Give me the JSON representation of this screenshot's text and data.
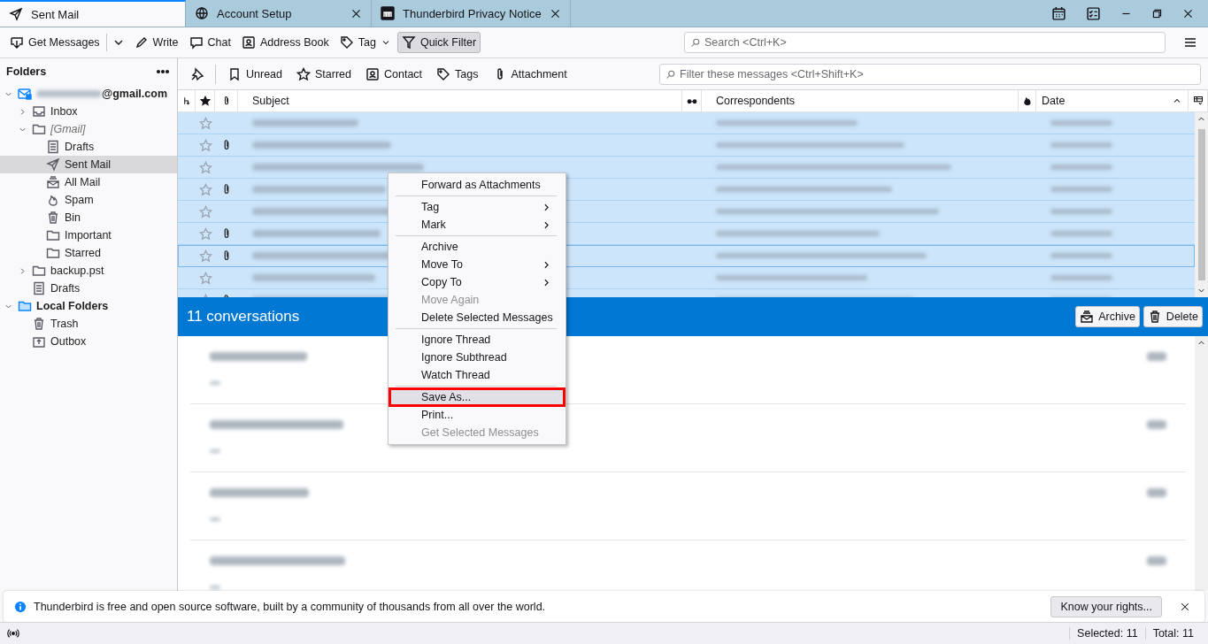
{
  "tabs": [
    {
      "label": "Sent Mail",
      "kind": "sent",
      "selected": true,
      "closable": false
    },
    {
      "label": "Account Setup",
      "kind": "globe",
      "selected": false,
      "closable": true
    },
    {
      "label": "Thunderbird Privacy Notice",
      "kind": "site",
      "selected": false,
      "closable": true
    }
  ],
  "toolbar": {
    "buttons": [
      {
        "kind": "button",
        "label": "Get Messages",
        "pressed": false
      },
      {
        "kind": "dropdown"
      },
      {
        "kind": "button",
        "label": "Write",
        "pressed": false
      },
      {
        "kind": "button",
        "label": "Chat",
        "pressed": false
      },
      {
        "kind": "button",
        "label": "Address Book",
        "pressed": false
      },
      {
        "kind": "menu-button",
        "label": "Tag",
        "pressed": false
      },
      {
        "kind": "button",
        "label": "Quick Filter",
        "pressed": true
      }
    ],
    "search": {
      "placeholder": "Search <Ctrl+K>"
    }
  },
  "folder_pane": {
    "title": "Folders",
    "tree": [
      {
        "label": "@gmail.com",
        "kind": "account",
        "expanded": true,
        "selected": false,
        "children": [
          {
            "label": "Inbox",
            "kind": "inbox",
            "expanded": false,
            "selected": false
          },
          {
            "label": "[Gmail]",
            "kind": "virtual",
            "expanded": true,
            "selected": false,
            "children": [
              {
                "label": "Drafts",
                "kind": "drafts",
                "selected": false
              },
              {
                "label": "Sent Mail",
                "kind": "sent",
                "selected": true
              },
              {
                "label": "All Mail",
                "kind": "archive",
                "selected": false
              },
              {
                "label": "Spam",
                "kind": "spam",
                "selected": false
              },
              {
                "label": "Bin",
                "kind": "bin",
                "selected": false
              },
              {
                "label": "Important",
                "kind": "folder",
                "selected": false
              },
              {
                "label": "Starred",
                "kind": "folder",
                "selected": false
              }
            ]
          },
          {
            "label": "backup.pst",
            "kind": "folder",
            "expanded": false,
            "selected": false
          },
          {
            "label": "Drafts",
            "kind": "drafts",
            "selected": false
          }
        ]
      },
      {
        "label": "Local Folders",
        "kind": "local",
        "expanded": true,
        "selected": false,
        "children": [
          {
            "label": "Trash",
            "kind": "bin",
            "selected": false
          },
          {
            "label": "Outbox",
            "kind": "outbox",
            "selected": false
          }
        ]
      }
    ]
  },
  "quick_filter": {
    "buttons": [
      {
        "label": "Unread",
        "kind": "bookmark",
        "selected": false
      },
      {
        "label": "Starred",
        "kind": "star",
        "selected": false
      },
      {
        "label": "Contact",
        "kind": "contact",
        "selected": false
      },
      {
        "label": "Tags",
        "kind": "tag",
        "selected": false
      },
      {
        "label": "Attachment",
        "kind": "clip",
        "selected": false
      }
    ],
    "placeholder": "Filter these messages <Ctrl+Shift+K>"
  },
  "message_list": {
    "columns": [
      {
        "kind": "thread"
      },
      {
        "kind": "star"
      },
      {
        "kind": "clip"
      },
      {
        "kind": "text",
        "label": "Subject"
      },
      {
        "kind": "read"
      },
      {
        "kind": "text",
        "label": "Correspondents"
      },
      {
        "kind": "junk"
      },
      {
        "kind": "text",
        "label": "Date",
        "sorted": true
      },
      {
        "kind": "picker"
      }
    ],
    "rows": [
      {
        "starred": false,
        "attachment": false,
        "selected": true,
        "focused": false
      },
      {
        "starred": false,
        "attachment": true,
        "selected": true,
        "focused": false
      },
      {
        "starred": false,
        "attachment": false,
        "selected": true,
        "focused": false
      },
      {
        "starred": false,
        "attachment": true,
        "selected": true,
        "focused": false
      },
      {
        "starred": false,
        "attachment": false,
        "selected": true,
        "focused": false
      },
      {
        "starred": false,
        "attachment": true,
        "selected": true,
        "focused": false
      },
      {
        "starred": false,
        "attachment": true,
        "selected": true,
        "focused": true
      },
      {
        "starred": false,
        "attachment": false,
        "selected": true,
        "focused": false
      },
      {
        "starred": false,
        "attachment": true,
        "selected": true,
        "focused": false
      }
    ]
  },
  "summary": {
    "heading": "11 conversations",
    "buttons": [
      {
        "label": "Archive",
        "kind": "archive"
      },
      {
        "label": "Delete",
        "kind": "bin"
      }
    ],
    "cards": [
      {
        "blurred": true
      },
      {
        "blurred": true
      },
      {
        "blurred": true
      },
      {
        "blurred": true
      }
    ]
  },
  "context_menu": [
    {
      "kind": "item",
      "label": "Forward as Attachments",
      "disabled": false,
      "submenu": false,
      "selected": false
    },
    {
      "kind": "separator"
    },
    {
      "kind": "item",
      "label": "Tag",
      "disabled": false,
      "submenu": true,
      "selected": false
    },
    {
      "kind": "item",
      "label": "Mark",
      "disabled": false,
      "submenu": true,
      "selected": false
    },
    {
      "kind": "separator"
    },
    {
      "kind": "item",
      "label": "Archive",
      "disabled": false,
      "submenu": false,
      "selected": false
    },
    {
      "kind": "item",
      "label": "Move To",
      "disabled": false,
      "submenu": true,
      "selected": false
    },
    {
      "kind": "item",
      "label": "Copy To",
      "disabled": false,
      "submenu": true,
      "selected": false
    },
    {
      "kind": "item",
      "label": "Move Again",
      "disabled": true,
      "submenu": false,
      "selected": false
    },
    {
      "kind": "item",
      "label": "Delete Selected Messages",
      "disabled": false,
      "submenu": false,
      "selected": false
    },
    {
      "kind": "separator"
    },
    {
      "kind": "item",
      "label": "Ignore Thread",
      "disabled": false,
      "submenu": false,
      "selected": false
    },
    {
      "kind": "item",
      "label": "Ignore Subthread",
      "disabled": false,
      "submenu": false,
      "selected": false
    },
    {
      "kind": "item",
      "label": "Watch Thread",
      "disabled": false,
      "submenu": false,
      "selected": false
    },
    {
      "kind": "separator"
    },
    {
      "kind": "item",
      "label": "Save As...",
      "disabled": false,
      "submenu": false,
      "selected": true,
      "outlined": true
    },
    {
      "kind": "item",
      "label": "Print...",
      "disabled": false,
      "submenu": false,
      "selected": false
    },
    {
      "kind": "item",
      "label": "Get Selected Messages",
      "disabled": true,
      "submenu": false,
      "selected": false
    }
  ],
  "notification": {
    "text": "Thunderbird is free and open source software, built by a community of thousands from all over the world.",
    "button": "Know your rights..."
  },
  "status_bar": {
    "selected": "Selected: 11",
    "total": "Total: 11"
  }
}
